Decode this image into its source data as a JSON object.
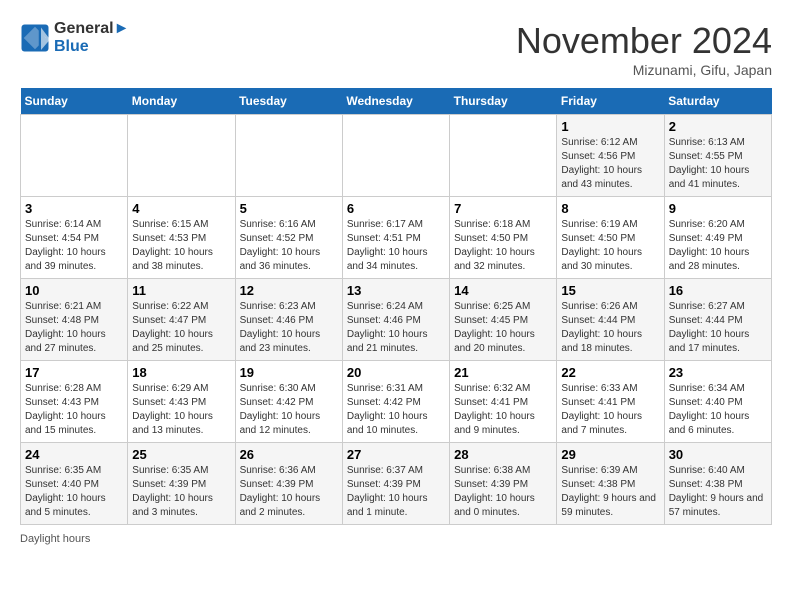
{
  "header": {
    "logo_line1": "General",
    "logo_line2": "Blue",
    "month_title": "November 2024",
    "location": "Mizunami, Gifu, Japan"
  },
  "footer": {
    "daylight_label": "Daylight hours"
  },
  "calendar": {
    "days_of_week": [
      "Sunday",
      "Monday",
      "Tuesday",
      "Wednesday",
      "Thursday",
      "Friday",
      "Saturday"
    ],
    "weeks": [
      [
        {
          "day": "",
          "info": ""
        },
        {
          "day": "",
          "info": ""
        },
        {
          "day": "",
          "info": ""
        },
        {
          "day": "",
          "info": ""
        },
        {
          "day": "",
          "info": ""
        },
        {
          "day": "1",
          "info": "Sunrise: 6:12 AM\nSunset: 4:56 PM\nDaylight: 10 hours\nand 43 minutes."
        },
        {
          "day": "2",
          "info": "Sunrise: 6:13 AM\nSunset: 4:55 PM\nDaylight: 10 hours\nand 41 minutes."
        }
      ],
      [
        {
          "day": "3",
          "info": "Sunrise: 6:14 AM\nSunset: 4:54 PM\nDaylight: 10 hours\nand 39 minutes."
        },
        {
          "day": "4",
          "info": "Sunrise: 6:15 AM\nSunset: 4:53 PM\nDaylight: 10 hours\nand 38 minutes."
        },
        {
          "day": "5",
          "info": "Sunrise: 6:16 AM\nSunset: 4:52 PM\nDaylight: 10 hours\nand 36 minutes."
        },
        {
          "day": "6",
          "info": "Sunrise: 6:17 AM\nSunset: 4:51 PM\nDaylight: 10 hours\nand 34 minutes."
        },
        {
          "day": "7",
          "info": "Sunrise: 6:18 AM\nSunset: 4:50 PM\nDaylight: 10 hours\nand 32 minutes."
        },
        {
          "day": "8",
          "info": "Sunrise: 6:19 AM\nSunset: 4:50 PM\nDaylight: 10 hours\nand 30 minutes."
        },
        {
          "day": "9",
          "info": "Sunrise: 6:20 AM\nSunset: 4:49 PM\nDaylight: 10 hours\nand 28 minutes."
        }
      ],
      [
        {
          "day": "10",
          "info": "Sunrise: 6:21 AM\nSunset: 4:48 PM\nDaylight: 10 hours\nand 27 minutes."
        },
        {
          "day": "11",
          "info": "Sunrise: 6:22 AM\nSunset: 4:47 PM\nDaylight: 10 hours\nand 25 minutes."
        },
        {
          "day": "12",
          "info": "Sunrise: 6:23 AM\nSunset: 4:46 PM\nDaylight: 10 hours\nand 23 minutes."
        },
        {
          "day": "13",
          "info": "Sunrise: 6:24 AM\nSunset: 4:46 PM\nDaylight: 10 hours\nand 21 minutes."
        },
        {
          "day": "14",
          "info": "Sunrise: 6:25 AM\nSunset: 4:45 PM\nDaylight: 10 hours\nand 20 minutes."
        },
        {
          "day": "15",
          "info": "Sunrise: 6:26 AM\nSunset: 4:44 PM\nDaylight: 10 hours\nand 18 minutes."
        },
        {
          "day": "16",
          "info": "Sunrise: 6:27 AM\nSunset: 4:44 PM\nDaylight: 10 hours\nand 17 minutes."
        }
      ],
      [
        {
          "day": "17",
          "info": "Sunrise: 6:28 AM\nSunset: 4:43 PM\nDaylight: 10 hours\nand 15 minutes."
        },
        {
          "day": "18",
          "info": "Sunrise: 6:29 AM\nSunset: 4:43 PM\nDaylight: 10 hours\nand 13 minutes."
        },
        {
          "day": "19",
          "info": "Sunrise: 6:30 AM\nSunset: 4:42 PM\nDaylight: 10 hours\nand 12 minutes."
        },
        {
          "day": "20",
          "info": "Sunrise: 6:31 AM\nSunset: 4:42 PM\nDaylight: 10 hours\nand 10 minutes."
        },
        {
          "day": "21",
          "info": "Sunrise: 6:32 AM\nSunset: 4:41 PM\nDaylight: 10 hours\nand 9 minutes."
        },
        {
          "day": "22",
          "info": "Sunrise: 6:33 AM\nSunset: 4:41 PM\nDaylight: 10 hours\nand 7 minutes."
        },
        {
          "day": "23",
          "info": "Sunrise: 6:34 AM\nSunset: 4:40 PM\nDaylight: 10 hours\nand 6 minutes."
        }
      ],
      [
        {
          "day": "24",
          "info": "Sunrise: 6:35 AM\nSunset: 4:40 PM\nDaylight: 10 hours\nand 5 minutes."
        },
        {
          "day": "25",
          "info": "Sunrise: 6:35 AM\nSunset: 4:39 PM\nDaylight: 10 hours\nand 3 minutes."
        },
        {
          "day": "26",
          "info": "Sunrise: 6:36 AM\nSunset: 4:39 PM\nDaylight: 10 hours\nand 2 minutes."
        },
        {
          "day": "27",
          "info": "Sunrise: 6:37 AM\nSunset: 4:39 PM\nDaylight: 10 hours\nand 1 minute."
        },
        {
          "day": "28",
          "info": "Sunrise: 6:38 AM\nSunset: 4:39 PM\nDaylight: 10 hours\nand 0 minutes."
        },
        {
          "day": "29",
          "info": "Sunrise: 6:39 AM\nSunset: 4:38 PM\nDaylight: 9 hours\nand 59 minutes."
        },
        {
          "day": "30",
          "info": "Sunrise: 6:40 AM\nSunset: 4:38 PM\nDaylight: 9 hours\nand 57 minutes."
        }
      ]
    ]
  }
}
